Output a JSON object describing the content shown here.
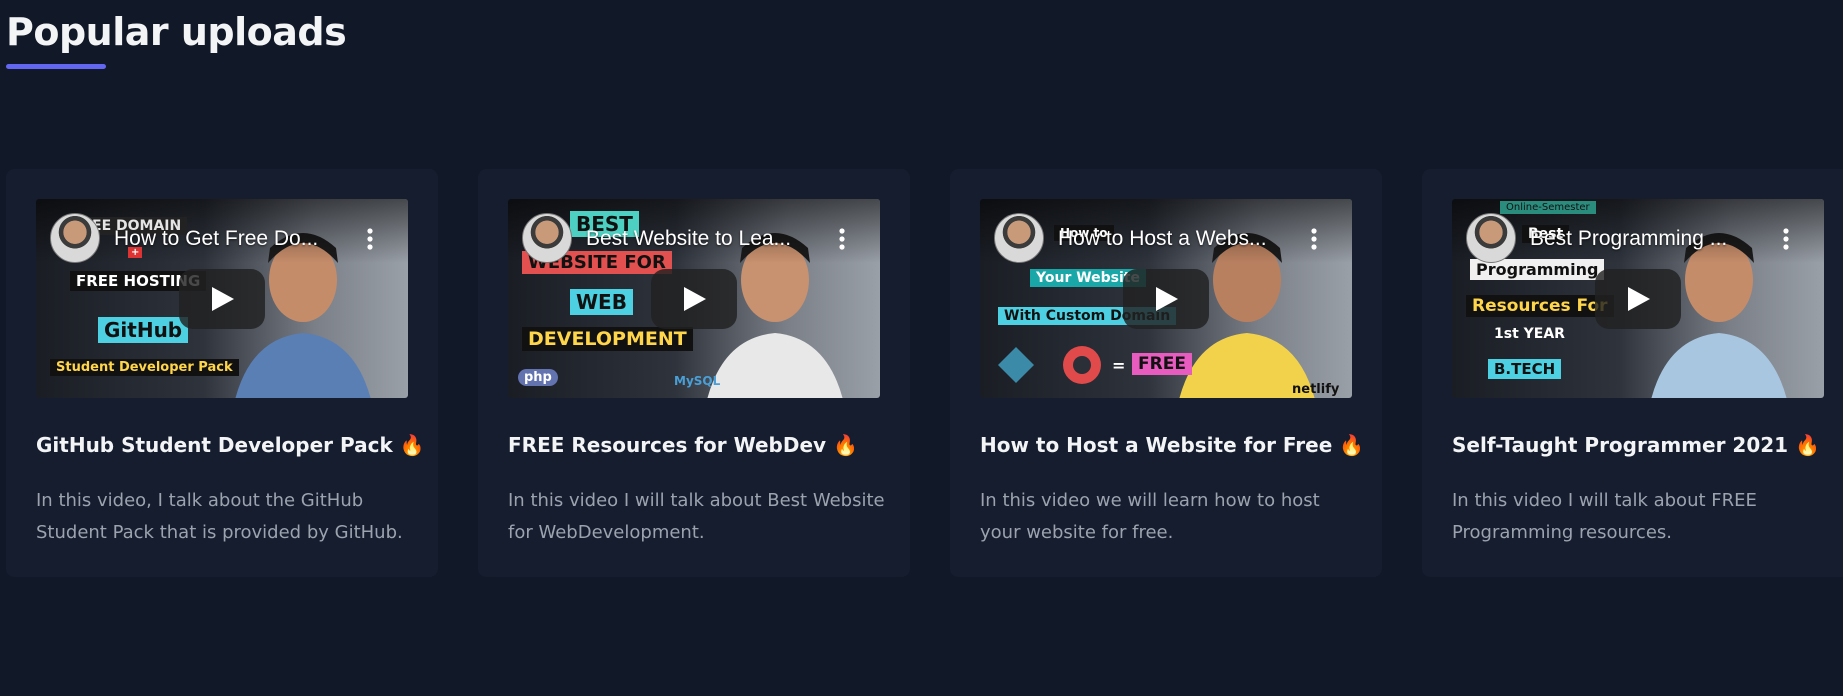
{
  "section": {
    "title": "Popular uploads"
  },
  "cards": [
    {
      "video_title": "How to Get Free Do...",
      "title": "GitHub Student Developer Pack",
      "emoji": "🔥",
      "description": "In this video, I talk about the GitHub Student Pack that is provided by GitHub.",
      "thumb_tags": [
        "EE DOMAIN",
        "+",
        "FREE HOSTING",
        "GitHub",
        "Student Developer Pack"
      ]
    },
    {
      "video_title": "Best Website to Lea...",
      "title": "FREE Resources for WebDev",
      "emoji": "🔥",
      "description": "In this video I will talk about Best Website for WebDevelopment.",
      "thumb_tags": [
        "BEST",
        "WEBSITE FOR",
        "WEB",
        "DEVELOPMENT",
        "php",
        "MySQL"
      ]
    },
    {
      "video_title": "How to Host a Webs...",
      "title": "How to Host a Website for Free",
      "emoji": "🔥",
      "description": "In this video we will learn how to host your website for free.",
      "thumb_tags": [
        "How to",
        "Your Website",
        "With Custom Domain",
        "=",
        "FREE",
        "netlify"
      ]
    },
    {
      "video_title": "Best Programming ...",
      "title": "Self-Taught Programmer 2021",
      "emoji": "🔥",
      "description": "In this video I will talk about FREE Programming resources.",
      "thumb_tags": [
        "Online-Semester",
        "Best",
        "Programming",
        "Resources For",
        "1st YEAR",
        "B.TECH"
      ]
    }
  ],
  "colors": {
    "background": "#111827",
    "card": "#151d2e",
    "accent_underline": "#6366f1",
    "title_text": "#f3f4f6",
    "desc_text": "#9ca3af"
  },
  "icons": {
    "more": "more-vertical-icon",
    "play": "play-icon"
  }
}
